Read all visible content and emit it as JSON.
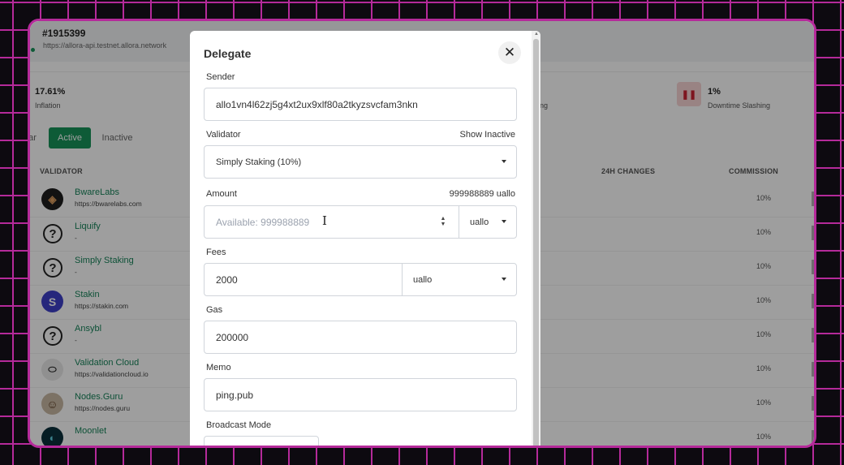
{
  "header": {
    "block_number": "#1915399",
    "api_url": "https://allora-api.testnet.allora.network"
  },
  "stats": {
    "inflation": {
      "value": "17.61%",
      "label": "Inflation"
    },
    "staking_fragment": "ng",
    "downtime": {
      "value": "1%",
      "label": "Downtime Slashing",
      "icon": "pause-icon"
    }
  },
  "tabs": {
    "cut": "ar",
    "active": "Active",
    "inactive": "Inactive"
  },
  "table": {
    "headers": {
      "validator": "VALIDATOR",
      "changes": "24H CHANGES",
      "commission": "COMMISSION"
    },
    "rows": [
      {
        "name": "BwareLabs",
        "site": "https://bwarelabs.com",
        "commission": "10%"
      },
      {
        "name": "Liquify",
        "site": "-",
        "commission": "10%"
      },
      {
        "name": "Simply Staking",
        "site": "-",
        "commission": "10%"
      },
      {
        "name": "Stakin",
        "site": "https://stakin.com",
        "commission": "10%"
      },
      {
        "name": "Ansybl",
        "site": "-",
        "commission": "10%"
      },
      {
        "name": "Validation Cloud",
        "site": "https://validationcloud.io",
        "commission": "10%"
      },
      {
        "name": "Nodes.Guru",
        "site": "https://nodes.guru",
        "commission": "10%"
      },
      {
        "name": "Moonlet",
        "site": "",
        "commission": "10%"
      }
    ]
  },
  "modal": {
    "title": "Delegate",
    "close_glyph": "✕",
    "sender_label": "Sender",
    "sender_value": "allo1vn4l62zj5g4xt2ux9xlf80a2tkyzsvcfam3nkn",
    "validator_label": "Validator",
    "show_inactive": "Show Inactive",
    "validator_value": "Simply Staking (10%)",
    "amount_label": "Amount",
    "amount_balance": "999988889 uallo",
    "amount_placeholder": "Available: 999988889",
    "amount_unit": "uallo",
    "fees_label": "Fees",
    "fees_value": "2000",
    "fees_unit": "uallo",
    "gas_label": "Gas",
    "gas_value": "200000",
    "memo_label": "Memo",
    "memo_value": "ping.pub",
    "broadcast_label": "Broadcast Mode"
  },
  "colors": {
    "accent": "#17945a",
    "grid_line": "#b52a9a"
  }
}
